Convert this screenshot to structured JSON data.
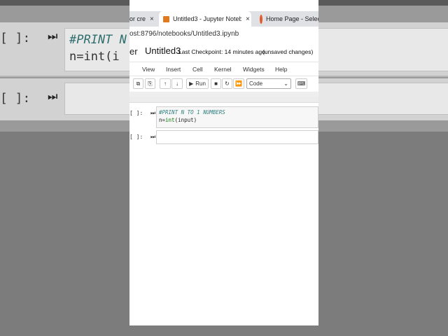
{
  "background": {
    "cell1_prompt": "[ ]:",
    "cell1_line1": "#PRINT N",
    "cell1_line2": "n=int(i",
    "cell2_prompt": "[ ]:"
  },
  "browser": {
    "tabs": [
      {
        "label": "or cre",
        "close": "×"
      },
      {
        "label": "Untitled3 - Jupyter Noteb",
        "close": "×"
      },
      {
        "label": "Home Page - Selec",
        "close": ""
      }
    ],
    "url": "ost:8796/notebooks/Untitled3.ipynb"
  },
  "header": {
    "logo_fragment": "er",
    "notebook_title": "Untitled3",
    "checkpoint": "Last Checkpoint: 14 minutes ago",
    "status": "(unsaved changes)"
  },
  "menu": [
    "View",
    "Insert",
    "Cell",
    "Kernel",
    "Widgets",
    "Help"
  ],
  "toolbar": {
    "run_label": "Run",
    "cell_type": "Code"
  },
  "cells": [
    {
      "prompt": "[ ]:",
      "comment": "#PRINT N TO 1 NUMBERS",
      "code_pre": "n=",
      "code_builtin": "int",
      "code_post": "(input)"
    },
    {
      "prompt": "[ ]:"
    }
  ],
  "colors": {
    "comment": "#2f7f7f",
    "builtin": "#008000",
    "tab_bar": "#dfe1e5"
  }
}
